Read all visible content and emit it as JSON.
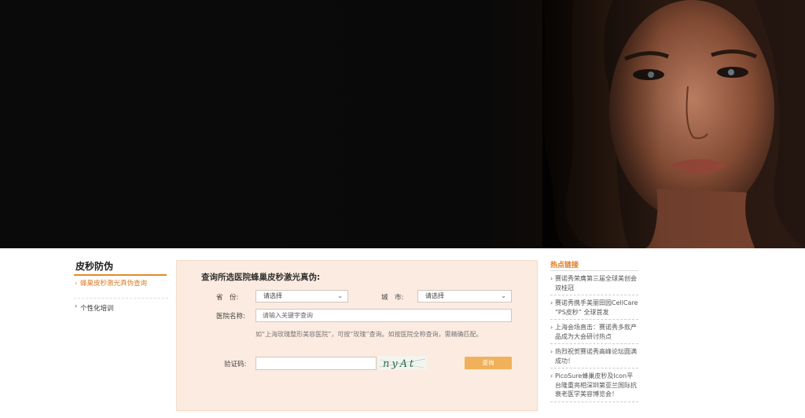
{
  "hero": {
    "alt": "banner-model-portrait"
  },
  "sidebar": {
    "title": "皮秒防伪",
    "items": [
      {
        "label": "蜂巢皮秒激光真伪查询",
        "active": true
      },
      {
        "label": "个性化培训",
        "active": false
      }
    ],
    "bullet": "›"
  },
  "query": {
    "title": "查询所选医院蜂巢皮秒激光真伪:",
    "province_label": "省　份:",
    "province_value": "请选择",
    "city_label": "城　市:",
    "city_value": "请选择",
    "hospital_label": "医院名称:",
    "hospital_placeholder": "请输入关键字查询",
    "hint": "如“上海玫瑰整形美容医院”，可按“玫瑰”查询。如按医院全称查询，需精确匹配。",
    "code_label": "验证码:",
    "code_value": "",
    "captcha_text": "nyAt",
    "submit_label": "查询",
    "chevron": "⌄"
  },
  "hot_links": {
    "title": "热点链接",
    "bullet": "›",
    "items": [
      "赛诺秀荣膺第三届全球美创会双桂冠",
      "赛诺秀携手美丽田园CellCare “PS皮秒” 全球首发",
      "上海会场直击：赛诺秀多款产品成为大会研讨热点",
      "热烈祝贺赛诺秀高峰论坛圆满成功！",
      "PicoSure蜂巢皮秒及Icon平台隆重亮相深圳第亚兰国际抗衰老医学美容博览会！"
    ]
  },
  "colors": {
    "accent": "#e07a1f",
    "button": "#f0b15a",
    "panel_bg": "#fcebe0"
  }
}
